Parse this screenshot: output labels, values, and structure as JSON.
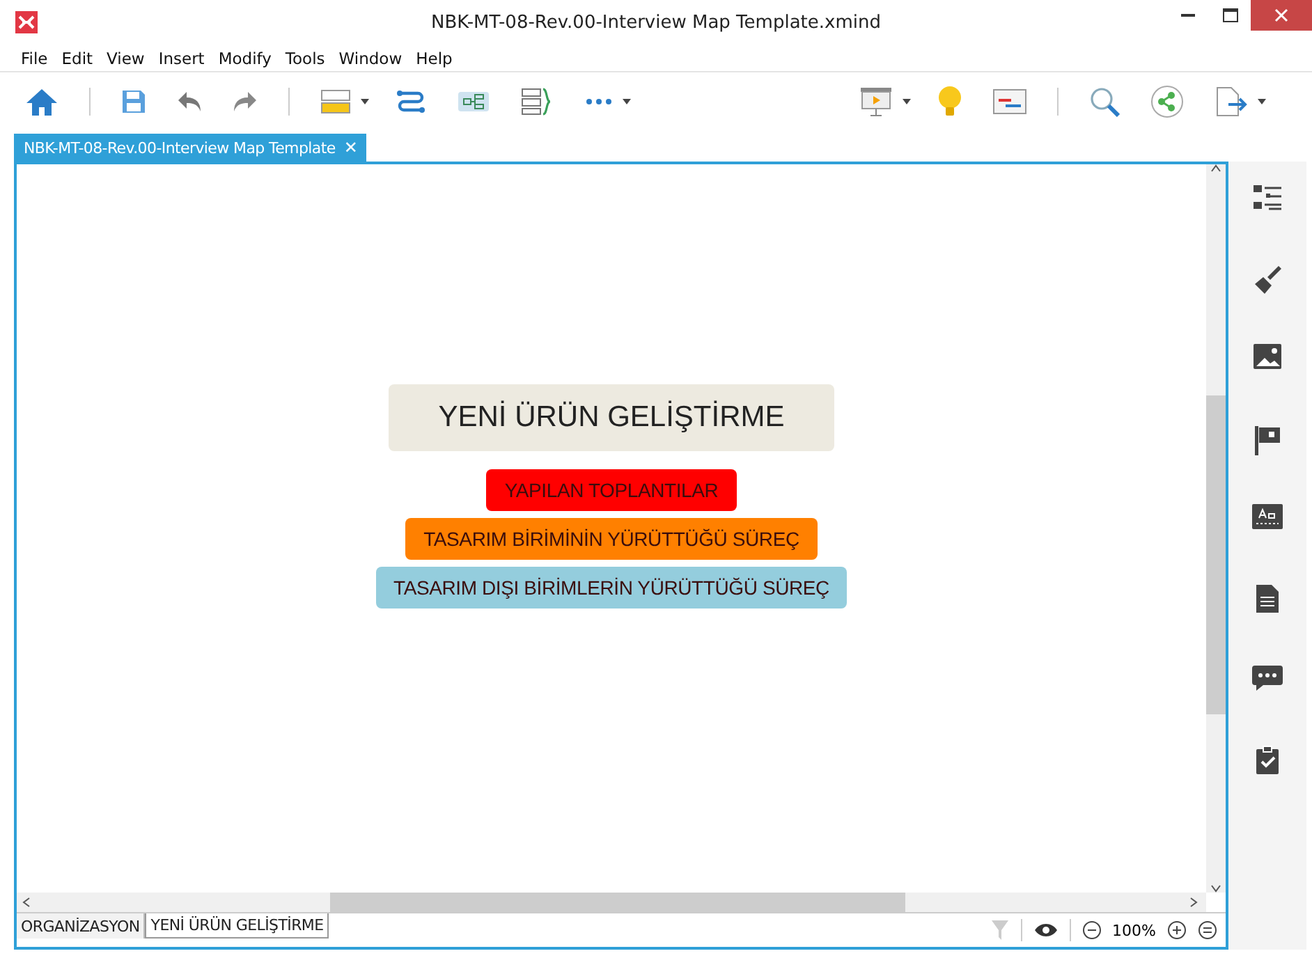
{
  "window": {
    "title": "NBK-MT-08-Rev.00-Interview Map Template.xmind"
  },
  "menu": [
    "File",
    "Edit",
    "View",
    "Insert",
    "Modify",
    "Tools",
    "Window",
    "Help"
  ],
  "editor_tab": {
    "label": "NBK-MT-08-Rev.00-Interview Map Template",
    "close": "✕"
  },
  "map": {
    "central_topic": "YENİ ÜRÜN GELİŞTİRME",
    "topics": [
      {
        "label": "YAPILAN TOPLANTILAR",
        "color": "#ff0000"
      },
      {
        "label": "TASARIM BİRİMİNİN YÜRÜTTÜĞÜ SÜREÇ",
        "color": "#ff8000"
      },
      {
        "label": "TASARIM DIŞI BİRİMLERİN YÜRÜTTÜĞÜ SÜREÇ",
        "color": "#94cddd"
      }
    ]
  },
  "sheets": [
    {
      "label": "ORGANİZASYON",
      "selected": false
    },
    {
      "label": "YENİ ÜRÜN GELİŞTİRME",
      "selected": true
    }
  ],
  "status": {
    "zoom": "100%"
  }
}
